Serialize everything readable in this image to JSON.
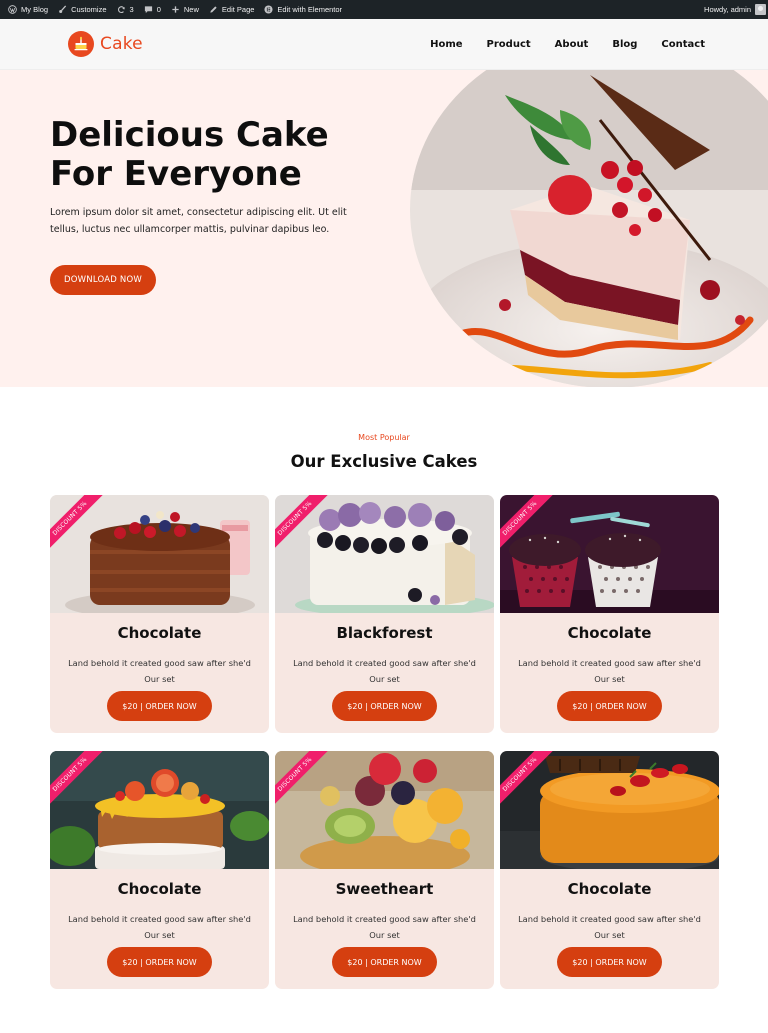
{
  "adminbar": {
    "items": [
      {
        "label": "My Blog",
        "icon": "wordpress-icon"
      },
      {
        "label": "Customize",
        "icon": "brush-icon"
      },
      {
        "label": "3",
        "icon": "updates-icon"
      },
      {
        "label": "0",
        "icon": "comment-icon"
      },
      {
        "label": "New",
        "icon": "plus-icon"
      },
      {
        "label": "Edit Page",
        "icon": "pencil-icon"
      },
      {
        "label": "Edit with Elementor",
        "icon": "elementor-icon"
      }
    ],
    "greeting": "Howdy, admin"
  },
  "header": {
    "logo_text": "Cake",
    "nav": [
      "Home",
      "Product",
      "About",
      "Blog",
      "Contact"
    ]
  },
  "hero": {
    "title": "Delicious Cake For Everyone",
    "text": "Lorem ipsum dolor sit amet, consectetur adipiscing elit. Ut elit tellus, luctus nec ullamcorper mattis, pulvinar dapibus leo.",
    "button": "DOWNLOAD NOW"
  },
  "section": {
    "eyebrow": "Most Popular",
    "title": "Our Exclusive Cakes"
  },
  "cards": [
    {
      "title": "Chocolate",
      "badge": "DISCOUNT 5%",
      "desc": "Land behold it created good saw after she'd Our set",
      "button": "$20 | ORDER NOW"
    },
    {
      "title": "Blackforest",
      "badge": "DISCOUNT 5%",
      "desc": "Land behold it created good saw after she'd Our set",
      "button": "$20 | ORDER NOW"
    },
    {
      "title": "Chocolate",
      "badge": "DISCOUNT 5%",
      "desc": "Land behold it created good saw after she'd Our set",
      "button": "$20 | ORDER NOW"
    },
    {
      "title": "Chocolate",
      "badge": "DISCOUNT 5%",
      "desc": "Land behold it created good saw after she'd Our set",
      "button": "$20 | ORDER NOW"
    },
    {
      "title": "Sweetheart",
      "badge": "DISCOUNT 5%",
      "desc": "Land behold it created good saw after she'd Our set",
      "button": "$20 | ORDER NOW"
    },
    {
      "title": "Chocolate",
      "badge": "DISCOUNT 5%",
      "desc": "Land behold it created good saw after she'd Our set",
      "button": "$20 | ORDER NOW"
    }
  ],
  "colors": {
    "brand": "#e8481f",
    "button": "#d53f10",
    "hero_bg": "#fff1ee",
    "card_bg": "#f7e7e2",
    "ribbon": "#f01f6b"
  }
}
